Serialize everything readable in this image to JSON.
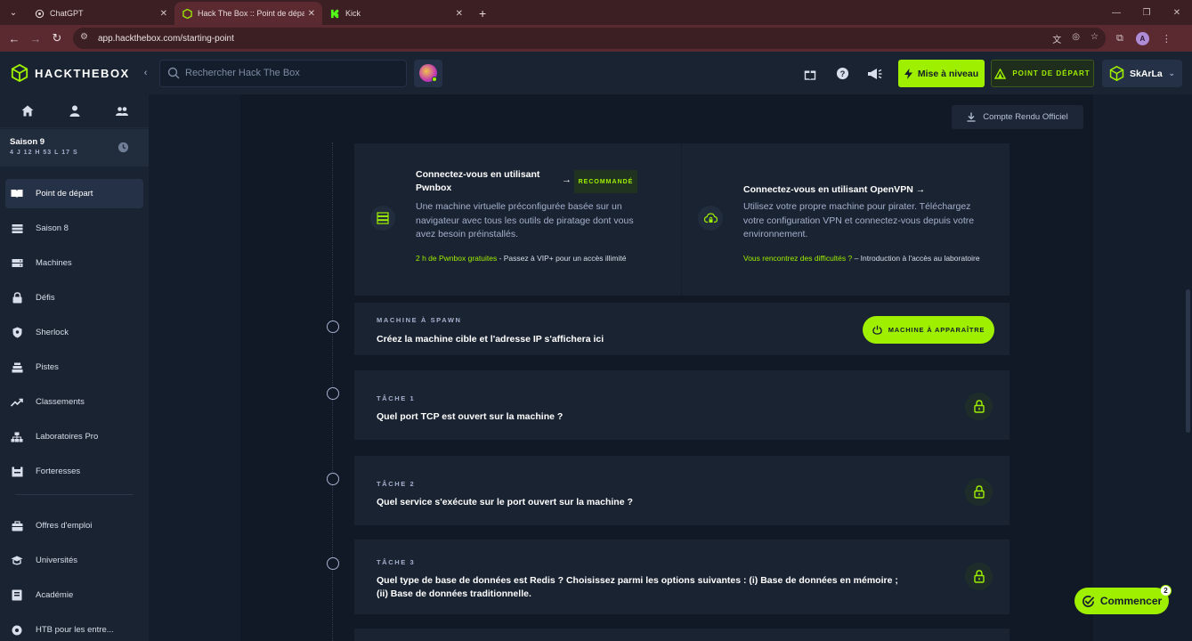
{
  "browser": {
    "tabs": [
      {
        "title": "ChatGPT",
        "active": false
      },
      {
        "title": "Hack The Box :: Point de départ",
        "active": true
      },
      {
        "title": "Kick",
        "active": false
      }
    ],
    "url": "app.hackthebox.com/starting-point",
    "profile_initial": "A"
  },
  "header": {
    "brand": "HACKTHEBOX",
    "search_placeholder": "Rechercher Hack The Box",
    "upgrade_label": "Mise à niveau",
    "starting_point_label": "POINT DE DÉPART",
    "username": "SkArLa"
  },
  "sidebar": {
    "season_name": "Saison 9",
    "season_time": "4 J 12 H 53 L 17 S",
    "items": [
      {
        "label": "Point de départ",
        "icon": "book-icon",
        "active": true
      },
      {
        "label": "Saison 8",
        "icon": "layers-icon",
        "active": false
      },
      {
        "label": "Machines",
        "icon": "server-icon",
        "active": false
      },
      {
        "label": "Défis",
        "icon": "lock-icon",
        "active": false
      },
      {
        "label": "Sherlock",
        "icon": "shield-icon",
        "active": false
      },
      {
        "label": "Pistes",
        "icon": "stack-icon",
        "active": false
      },
      {
        "label": "Classements",
        "icon": "trend-icon",
        "active": false
      },
      {
        "label": "Laboratoires Pro",
        "icon": "network-icon",
        "active": false
      },
      {
        "label": "Forteresses",
        "icon": "fortress-icon",
        "active": false
      }
    ],
    "secondary_items": [
      {
        "label": "Offres d'emploi",
        "icon": "briefcase-icon"
      },
      {
        "label": "Universités",
        "icon": "graduation-icon"
      },
      {
        "label": "Académie",
        "icon": "academy-icon"
      },
      {
        "label": "HTB pour les entre...",
        "icon": "business-icon"
      }
    ]
  },
  "main": {
    "writeup_label": "Compte Rendu Officiel",
    "connect": {
      "pwnbox": {
        "title": "Connectez-vous en utilisant Pwnbox",
        "badge": "RECOMMANDÉ",
        "description": "Une machine virtuelle préconfigurée basée sur un navigateur avec tous les outils de piratage dont vous avez besoin préinstallés.",
        "foot_highlight": "2 h de Pwnbox gratuites",
        "foot_rest": " - Passez à VIP+ pour un accès illimité"
      },
      "openvpn": {
        "title": "Connectez-vous en utilisant OpenVPN",
        "description": "Utilisez votre propre machine pour pirater. Téléchargez votre configuration VPN et connectez-vous depuis votre environnement.",
        "foot_highlight": "Vous rencontrez des difficultés ?",
        "foot_rest": " – Introduction à l'accès au laboratoire"
      }
    },
    "spawn": {
      "label": "MACHINE À SPAWN",
      "text": "Créez la machine cible et l'adresse IP s'affichera ici",
      "button": "MACHINE À APPARAÎTRE"
    },
    "tasks": [
      {
        "label": "TÂCHE 1",
        "question": "Quel port TCP est ouvert sur la machine ?"
      },
      {
        "label": "TÂCHE 2",
        "question": "Quel service s'exécute sur le port ouvert sur la machine ?"
      },
      {
        "label": "TÂCHE 3",
        "question": "Quel type de base de données est Redis ? Choisissez parmi les options suivantes : (i) Base de données en mémoire ; (ii) Base de données traditionnelle."
      }
    ]
  },
  "floating": {
    "commencer_label": "Commencer",
    "badge_count": "2"
  },
  "colors": {
    "accent": "#9fef00",
    "bg": "#141d2b",
    "panel": "#1a2332",
    "muted_text": "#a4b1cd",
    "browser_chrome": "#5a2a30"
  }
}
